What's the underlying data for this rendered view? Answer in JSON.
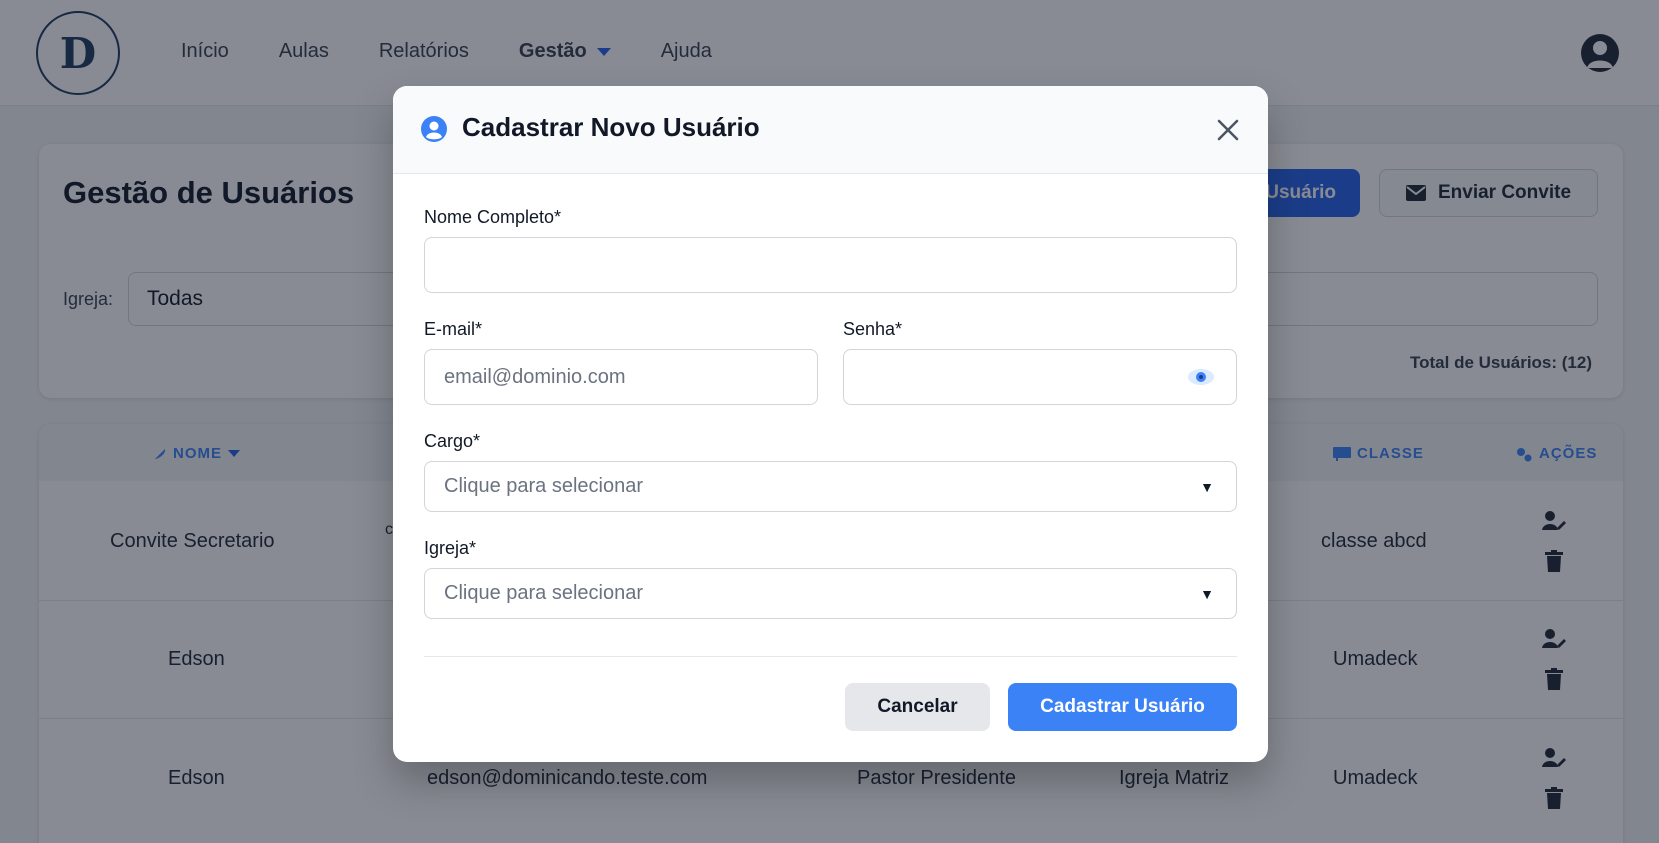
{
  "nav": {
    "logo_text": "D",
    "items": [
      {
        "label": "Início"
      },
      {
        "label": "Aulas"
      },
      {
        "label": "Relatórios"
      },
      {
        "label": "Gestão"
      },
      {
        "label": "Ajuda"
      }
    ]
  },
  "page": {
    "title": "Gestão de Usuários",
    "new_user_button_partial": "Usuário",
    "invite_button": "Enviar Convite",
    "filter_label": "Igreja:",
    "filter_value": "Todas",
    "total_users": "Total de Usuários: (12)"
  },
  "table": {
    "headers": {
      "nome": "NOME",
      "classe": "CLASSE",
      "acoes": "AÇÕES"
    },
    "rows": [
      {
        "nome": "Convite Secretario",
        "email_partial": "c",
        "cargo": "",
        "igreja": "",
        "classe": "classe abcd"
      },
      {
        "nome": "Edson",
        "email_partial": "",
        "cargo": "",
        "igreja": "",
        "classe": "Umadeck"
      },
      {
        "nome": "Edson",
        "email": "edson@dominicando.teste.com",
        "cargo": "Pastor Presidente",
        "igreja": "Igreja Matriz",
        "classe": "Umadeck"
      }
    ]
  },
  "modal": {
    "title": "Cadastrar Novo Usuário",
    "fields": {
      "nome_label": "Nome Completo*",
      "nome_value": "",
      "email_label": "E-mail*",
      "email_placeholder": "email@dominio.com",
      "senha_label": "Senha*",
      "senha_value": "",
      "cargo_label": "Cargo*",
      "cargo_placeholder": "Clique para selecionar",
      "igreja_label": "Igreja*",
      "igreja_placeholder": "Clique para selecionar"
    },
    "cancel_button": "Cancelar",
    "submit_button": "Cadastrar Usuário",
    "select_arrow": "▼"
  },
  "colors": {
    "primary": "#3b82f6",
    "overlay": "rgba(17,24,39,0.5)"
  }
}
